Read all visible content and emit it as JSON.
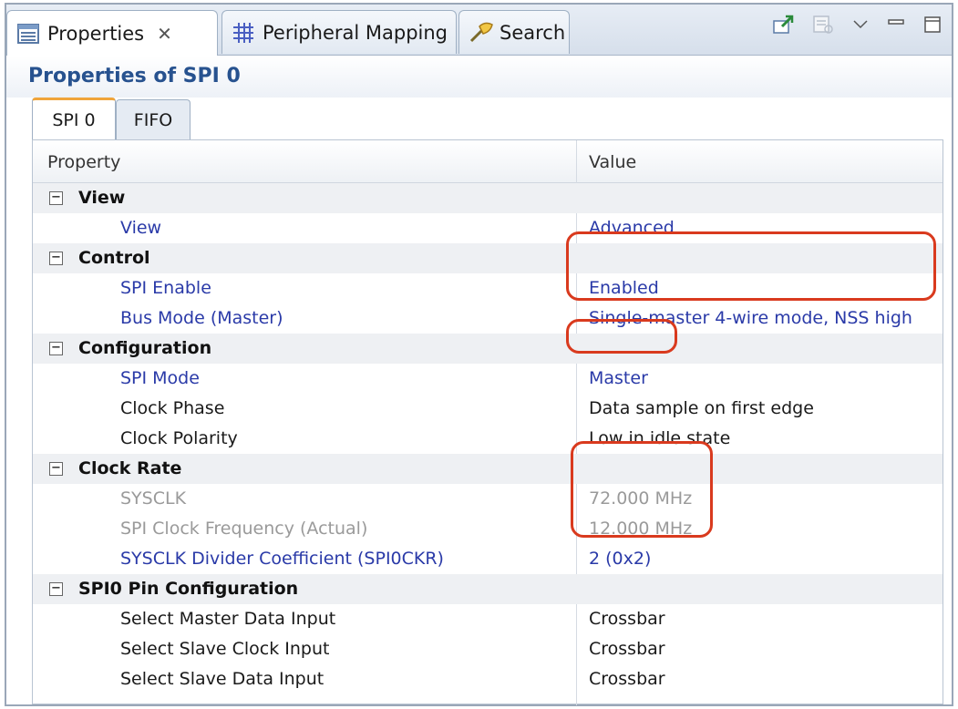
{
  "tabs": [
    {
      "label": "Properties",
      "icon": "properties-icon",
      "active": true
    },
    {
      "label": "Peripheral Mapping",
      "icon": "grid-icon"
    },
    {
      "label": "Search",
      "icon": "search-icon"
    }
  ],
  "panel_title": "Properties of SPI 0",
  "inner_tabs": [
    "SPI 0",
    "FIFO"
  ],
  "columns": {
    "property": "Property",
    "value": "Value"
  },
  "sections": [
    {
      "label": "View",
      "rows": [
        {
          "label": "View",
          "value": "Advanced"
        }
      ]
    },
    {
      "label": "Control",
      "rows": [
        {
          "label": "SPI Enable",
          "value": "Enabled"
        },
        {
          "label": "Bus Mode (Master)",
          "value": "Single-master 4-wire mode, NSS high"
        }
      ]
    },
    {
      "label": "Configuration",
      "rows": [
        {
          "label": "SPI Mode",
          "value": "Master"
        },
        {
          "label": "Clock Phase",
          "value": "Data sample on first edge"
        },
        {
          "label": "Clock Polarity",
          "value": "Low in idle state"
        }
      ]
    },
    {
      "label": "Clock Rate",
      "rows": [
        {
          "label": "SYSCLK",
          "value": "72.000 MHz"
        },
        {
          "label": "SPI Clock Frequency (Actual)",
          "value": "12.000 MHz"
        },
        {
          "label": "SYSCLK Divider Coefficient (SPI0CKR)",
          "value": "2 (0x2)"
        }
      ]
    },
    {
      "label": "SPI0 Pin Configuration",
      "rows": [
        {
          "label": "Select Master Data Input",
          "value": "Crossbar"
        },
        {
          "label": "Select Slave Clock Input",
          "value": "Crossbar"
        },
        {
          "label": "Select Slave Data Input",
          "value": "Crossbar"
        }
      ]
    }
  ],
  "colors": {
    "highlight": "#d93a1e",
    "link_blue": "#2a3aa8",
    "title_blue": "#27528f",
    "disabled_grey": "#9a9a9a"
  }
}
